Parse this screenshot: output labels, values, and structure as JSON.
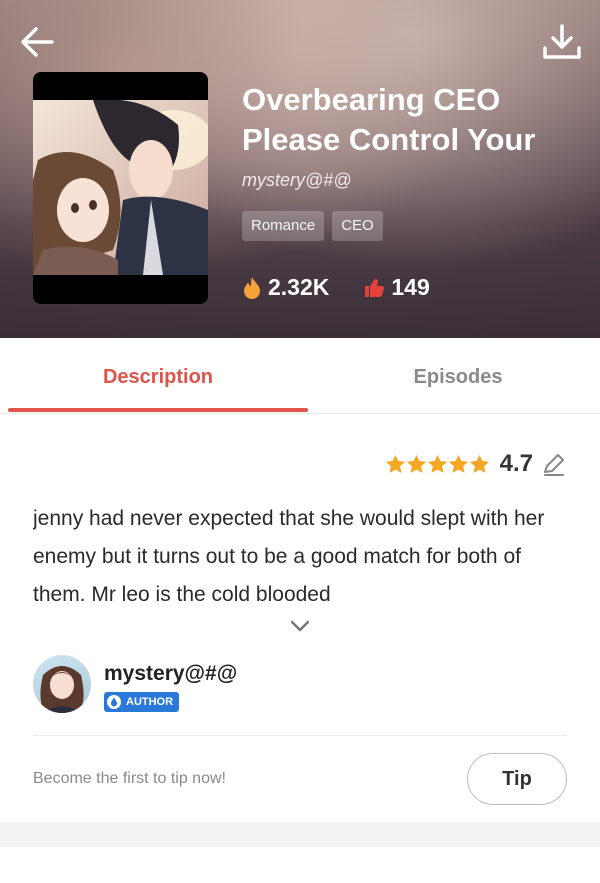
{
  "header": {
    "title": "Overbearing CEO Please Control Your",
    "author": "mystery@#@",
    "tags": [
      "Romance",
      "CEO"
    ],
    "stats": {
      "views": "2.32K",
      "likes": "149"
    }
  },
  "tabs": [
    {
      "label": "Description",
      "active": true
    },
    {
      "label": "Episodes",
      "active": false
    }
  ],
  "rating": {
    "value": "4.7",
    "stars": 5
  },
  "description": "jenny had never expected that she would slept with her enemy but it turns out to be a good match for both of them. Mr leo is the cold blooded",
  "author_section": {
    "name": "mystery@#@",
    "badge": "AUTHOR"
  },
  "tip": {
    "prompt": "Become the first to tip now!",
    "button": "Tip"
  },
  "colors": {
    "accent": "#e0534a",
    "star": "#f5a623",
    "badge": "#2a79d8",
    "flame": "#f6a23a"
  },
  "icons": [
    "back-arrow-icon",
    "download-icon",
    "flame-icon",
    "thumbs-up-icon",
    "star-icon",
    "edit-pencil-icon",
    "chevron-down-icon",
    "author-badge-icon"
  ]
}
